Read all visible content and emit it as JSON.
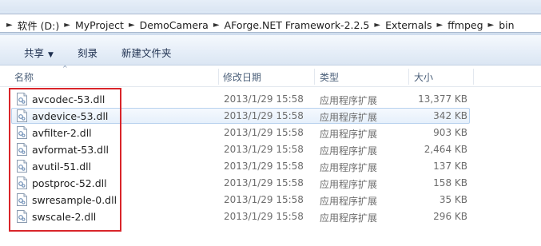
{
  "address": {
    "crumbs": [
      "软件 (D:)",
      "MyProject",
      "DemoCamera",
      "AForge.NET Framework-2.2.5",
      "Externals",
      "ffmpeg",
      "bin"
    ]
  },
  "toolbar": {
    "share_label": "共享",
    "burn_label": "刻录",
    "new_folder_label": "新建文件夹"
  },
  "columns": {
    "name": "名称",
    "date": "修改日期",
    "type": "类型",
    "size": "大小"
  },
  "files": [
    {
      "name": "avcodec-53.dll",
      "date": "2013/1/29 15:58",
      "type": "应用程序扩展",
      "size": "13,377 KB"
    },
    {
      "name": "avdevice-53.dll",
      "date": "2013/1/29 15:58",
      "type": "应用程序扩展",
      "size": "342 KB"
    },
    {
      "name": "avfilter-2.dll",
      "date": "2013/1/29 15:58",
      "type": "应用程序扩展",
      "size": "903 KB"
    },
    {
      "name": "avformat-53.dll",
      "date": "2013/1/29 15:58",
      "type": "应用程序扩展",
      "size": "2,464 KB"
    },
    {
      "name": "avutil-51.dll",
      "date": "2013/1/29 15:58",
      "type": "应用程序扩展",
      "size": "137 KB"
    },
    {
      "name": "postproc-52.dll",
      "date": "2013/1/29 15:58",
      "type": "应用程序扩展",
      "size": "158 KB"
    },
    {
      "name": "swresample-0.dll",
      "date": "2013/1/29 15:58",
      "type": "应用程序扩展",
      "size": "35 KB"
    },
    {
      "name": "swscale-2.dll",
      "date": "2013/1/29 15:58",
      "type": "应用程序扩展",
      "size": "296 KB"
    }
  ],
  "selected_file": "avdevice-53.dll",
  "colors": {
    "highlight_border": "#d9252a",
    "selection_border": "#b8d2ee"
  },
  "icons": [
    "chevron-right-icon",
    "dropdown-arrow-icon",
    "sort-caret-icon",
    "dll-file-icon"
  ]
}
